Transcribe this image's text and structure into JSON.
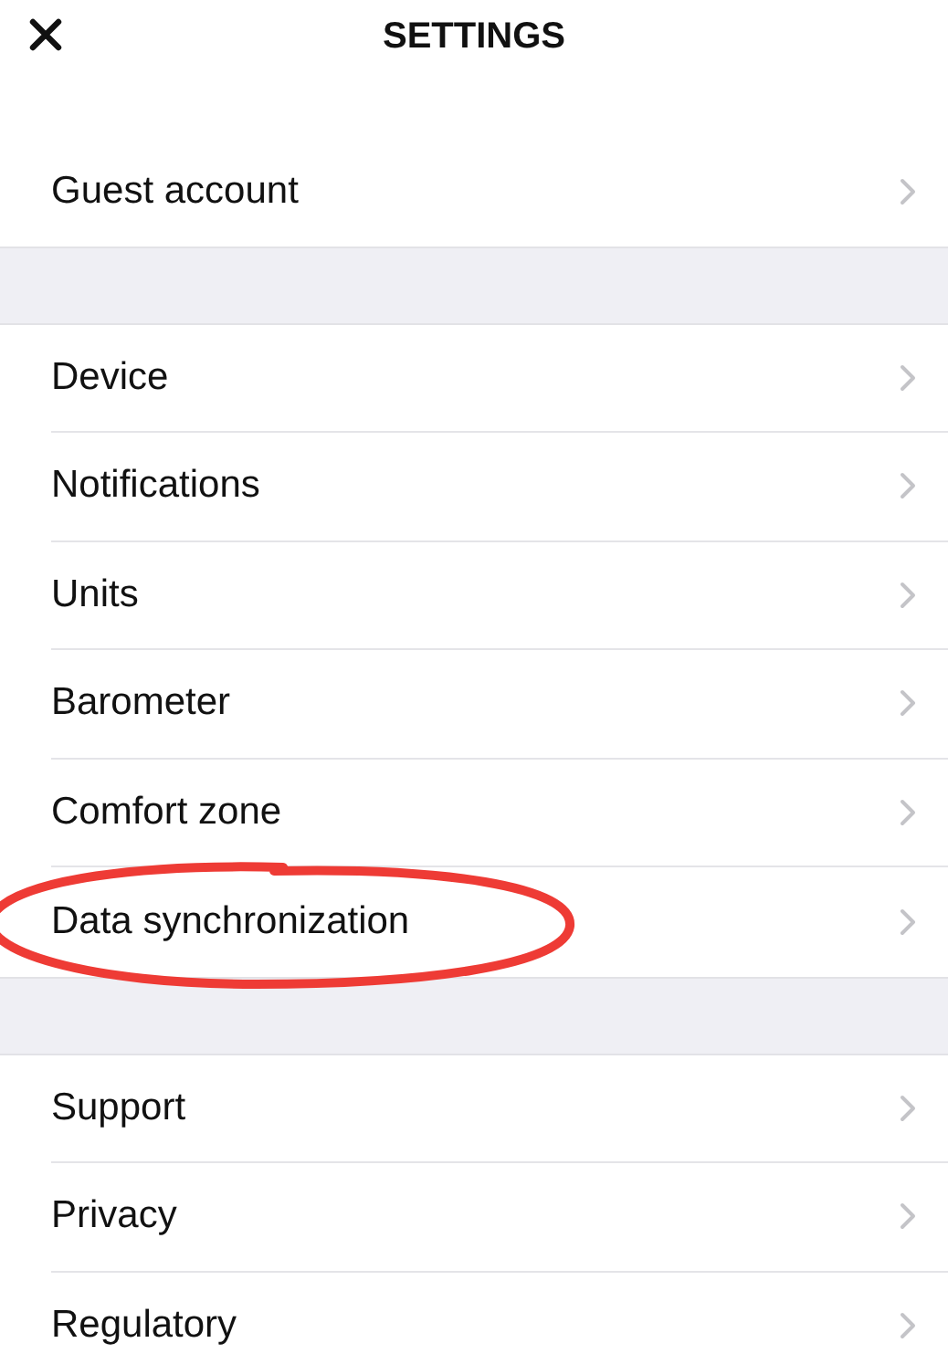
{
  "header": {
    "title": "SETTINGS"
  },
  "groups": [
    {
      "items": [
        {
          "label": "Guest account",
          "circled": false
        }
      ]
    },
    {
      "items": [
        {
          "label": "Device",
          "circled": false
        },
        {
          "label": "Notifications",
          "circled": false
        },
        {
          "label": "Units",
          "circled": false
        },
        {
          "label": "Barometer",
          "circled": false
        },
        {
          "label": "Comfort zone",
          "circled": false
        },
        {
          "label": "Data synchronization",
          "circled": true
        }
      ]
    },
    {
      "items": [
        {
          "label": "Support",
          "circled": false
        },
        {
          "label": "Privacy",
          "circled": false
        },
        {
          "label": "Regulatory",
          "circled": false
        }
      ]
    }
  ],
  "annotation": {
    "kind": "ellipse",
    "color": "#ee3b35"
  }
}
